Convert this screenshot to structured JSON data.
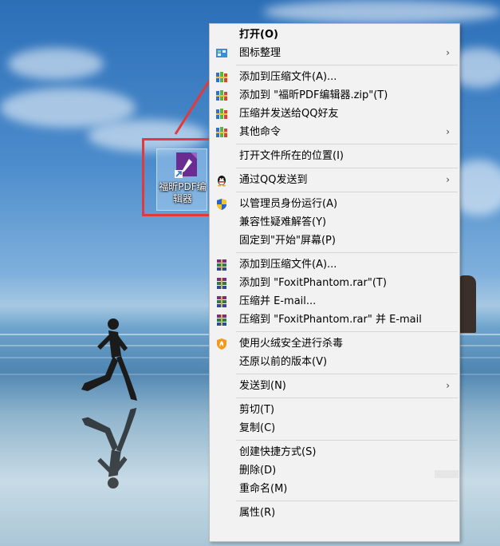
{
  "desktop": {
    "icon": {
      "label": "福昕PDF编辑器",
      "icon_name": "foxit-pdf-editor-icon",
      "brand_color": "#6b2c91"
    },
    "highlight_color": "#e23a3a"
  },
  "context_menu": {
    "items": [
      {
        "id": "open",
        "label": "打开(O)",
        "bold": true,
        "icon": ""
      },
      {
        "id": "icon-arrange",
        "label": "图标整理",
        "submenu": true,
        "icon": "arrange-icon"
      },
      {
        "id": "add-archive",
        "label": "添加到压缩文件(A)...",
        "icon": "winrar-icon"
      },
      {
        "id": "add-zip",
        "label": "添加到 \"福昕PDF编辑器.zip\"(T)",
        "icon": "winrar-icon"
      },
      {
        "id": "compress-qq",
        "label": "压缩并发送给QQ好友",
        "icon": "winrar-icon"
      },
      {
        "id": "other-commands",
        "label": "其他命令",
        "submenu": true,
        "icon": "winrar-icon"
      },
      {
        "id": "open-location",
        "label": "打开文件所在的位置(I)",
        "icon": ""
      },
      {
        "id": "send-qq",
        "label": "通过QQ发送到",
        "submenu": true,
        "icon": "qq-penguin-icon"
      },
      {
        "id": "run-admin",
        "label": "以管理员身份运行(A)",
        "icon": "uac-shield-icon"
      },
      {
        "id": "compat",
        "label": "兼容性疑难解答(Y)",
        "icon": ""
      },
      {
        "id": "pin-start",
        "label": "固定到\"开始\"屏幕(P)",
        "icon": ""
      },
      {
        "id": "rar-add",
        "label": "添加到压缩文件(A)...",
        "icon": "rar-books-icon"
      },
      {
        "id": "rar-add-name",
        "label": "添加到 \"FoxitPhantom.rar\"(T)",
        "icon": "rar-books-icon"
      },
      {
        "id": "rar-email",
        "label": "压缩并 E-mail...",
        "icon": "rar-books-icon"
      },
      {
        "id": "rar-name-email",
        "label": "压缩到 \"FoxitPhantom.rar\" 并 E-mail",
        "icon": "rar-books-icon"
      },
      {
        "id": "huorong-scan",
        "label": "使用火绒安全进行杀毒",
        "icon": "huorong-shield-icon"
      },
      {
        "id": "restore-version",
        "label": "还原以前的版本(V)",
        "icon": ""
      },
      {
        "id": "send-to",
        "label": "发送到(N)",
        "submenu": true,
        "icon": ""
      },
      {
        "id": "cut",
        "label": "剪切(T)",
        "icon": ""
      },
      {
        "id": "copy",
        "label": "复制(C)",
        "icon": ""
      },
      {
        "id": "create-shortcut",
        "label": "创建快捷方式(S)",
        "icon": ""
      },
      {
        "id": "delete",
        "label": "删除(D)",
        "icon": ""
      },
      {
        "id": "rename",
        "label": "重命名(M)",
        "icon": ""
      },
      {
        "id": "properties",
        "label": "属性(R)",
        "icon": ""
      }
    ],
    "chevron_glyph": "›"
  }
}
